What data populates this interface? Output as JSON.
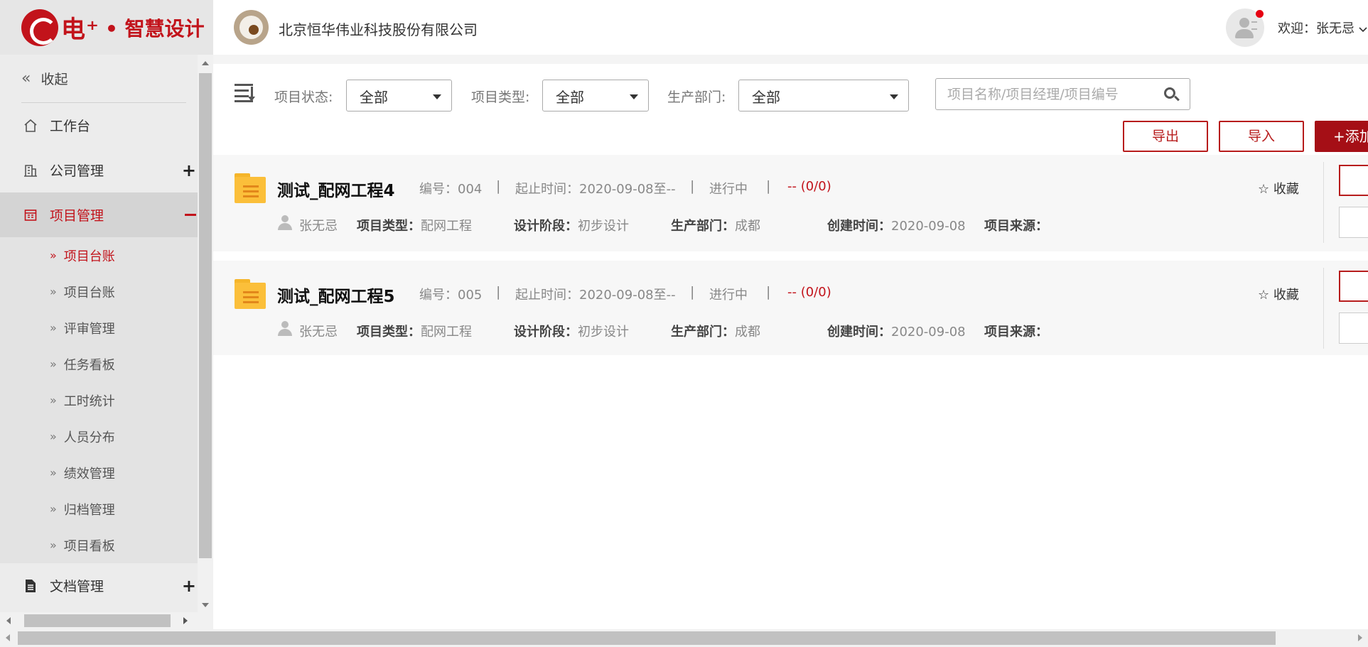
{
  "brand": {
    "logo_text": "电⁺",
    "logo_sub": "• 智慧设计",
    "accent": "#c2131b"
  },
  "header": {
    "company_name": "北京恒华伟业科技股份有限公司",
    "welcome": "欢迎：张无忌 ",
    "has_notification": true
  },
  "sidebar": {
    "collapse_label": "收起",
    "menu": [
      {
        "label": "工作台",
        "icon": "home-icon"
      },
      {
        "label": "公司管理",
        "icon": "building-icon",
        "expand": "+"
      },
      {
        "label": "项目管理",
        "icon": "calendar-icon",
        "expand": "−",
        "active": true
      },
      {
        "label": "文档管理",
        "icon": "document-icon",
        "expand": "+"
      }
    ],
    "submenu": [
      {
        "label": "项目台账",
        "active": true
      },
      {
        "label": "项目台账"
      },
      {
        "label": "评审管理"
      },
      {
        "label": "任务看板"
      },
      {
        "label": "工时统计"
      },
      {
        "label": "人员分布"
      },
      {
        "label": "绩效管理"
      },
      {
        "label": "归档管理"
      },
      {
        "label": "项目看板"
      }
    ]
  },
  "filters": {
    "status_label": "项目状态:",
    "status_value": "全部",
    "type_label": "项目类型:",
    "type_value": "全部",
    "dept_label": "生产部门:",
    "dept_value": "全部",
    "search_placeholder": "项目名称/项目经理/项目编号"
  },
  "actions": {
    "export_label": "导出",
    "import_label": "导入",
    "add_label": "+添加"
  },
  "projects": [
    {
      "title": "测试_配网工程4",
      "code": "编号：004",
      "dates": "起止时间：2020-09-08至--",
      "status": "进行中",
      "progress": "-- (0/0)",
      "fav": "☆ 收藏",
      "manager": "张无忌",
      "type_k": "项目类型：",
      "type_v": "配网工程",
      "stage_k": "设计阶段：",
      "stage_v": "初步设计",
      "dept_k": "生产部门：",
      "dept_v": "成都",
      "created_k": "创建时间：",
      "created_v": "2020-09-08",
      "source_k": "项目来源：",
      "source_v": ""
    },
    {
      "title": "测试_配网工程5",
      "code": "编号：005",
      "dates": "起止时间：2020-09-08至--",
      "status": "进行中",
      "progress": "-- (0/0)",
      "fav": "☆ 收藏",
      "manager": "张无忌",
      "type_k": "项目类型：",
      "type_v": "配网工程",
      "stage_k": "设计阶段：",
      "stage_v": "初步设计",
      "dept_k": "生产部门：",
      "dept_v": "成都",
      "created_k": "创建时间：",
      "created_v": "2020-09-08",
      "source_k": "项目来源：",
      "source_v": ""
    }
  ]
}
